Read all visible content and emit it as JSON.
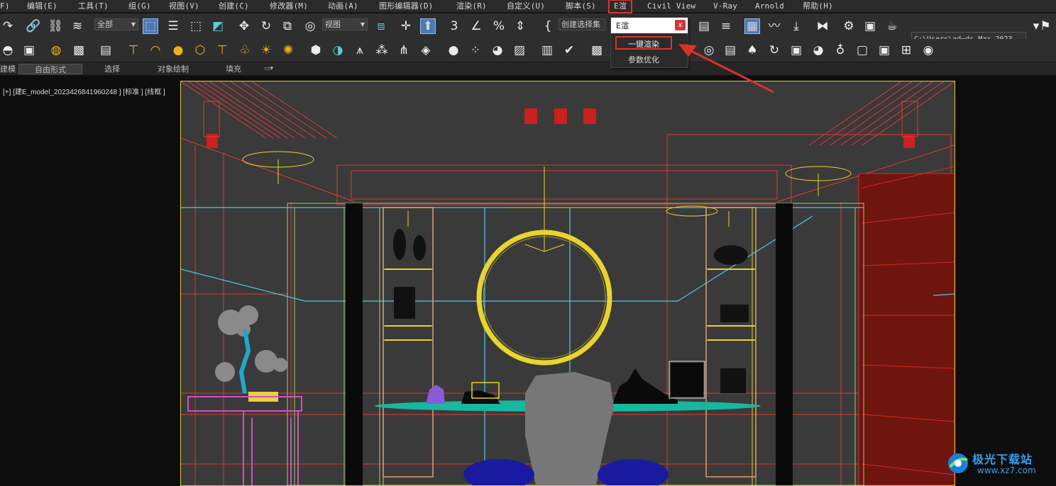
{
  "menubar": {
    "items": [
      "F)",
      "编辑(E)",
      "工具(T)",
      "组(G)",
      "视图(V)",
      "创建(C)",
      "修改器(M)",
      "动画(A)",
      "图形编辑器(D)",
      "渲染(R)",
      "自定义(U)",
      "脚本(S)",
      "E渲",
      "Civil View",
      "V-Ray",
      "Arnold",
      "帮助(H)"
    ],
    "highlighted_item": "E渲"
  },
  "toolbar1": {
    "selection_filter": "全部",
    "ref_coord": "视图",
    "named_selection": "创建选择集",
    "path_value": "C:\\Users\\ad⋯ds Max 2023",
    "icons": [
      "redo-icon",
      "link-icon",
      "unlink-icon",
      "bind-space-warp-icon",
      "select-object-icon",
      "select-by-name-icon",
      "rect-region-icon",
      "window-crossing-icon",
      "move-icon",
      "rotate-icon",
      "scale-icon",
      "placement-icon",
      "mirror-icon",
      "align-icon",
      "pivot-center-icon",
      "use-pivot-icon",
      "snap-3-icon",
      "angle-snap-icon",
      "percent-snap-icon",
      "spinner-snap-icon",
      "edit-named-selection-icon",
      "layer-explorer-icon",
      "toggle-ribbon-icon",
      "curve-editor-icon",
      "schematic-view-icon",
      "material-editor-icon",
      "render-setup-icon",
      "rendered-frame-icon",
      "render-icon",
      "render-production-icon"
    ]
  },
  "toolbar2": {
    "icons": [
      "vray-light-icon",
      "box-icon",
      "teapot-icon",
      "camera-icon",
      "film-icon",
      "spot-light-icon",
      "dome-light-icon",
      "sphere-light-icon",
      "mesh-light-icon",
      "ies-light-icon",
      "sun-icon",
      "sky-icon",
      "proxy-icon",
      "fur-icon",
      "plane-icon",
      "sphere-icon",
      "balls-icon",
      "palette-icon",
      "frame-buffer-icon",
      "stats-icon",
      "vray-logo-icon"
    ]
  },
  "ribbon": {
    "tabs": [
      "建模",
      "自由形式",
      "选择",
      "对象绘制",
      "填充"
    ]
  },
  "viewport": {
    "label": "[+] [建E_model_2023426841960248 ] [标准 ] [线框 ]"
  },
  "popup": {
    "title": "E渲",
    "close": "x",
    "items": [
      "一键渲染",
      "参数优化"
    ]
  },
  "watermark": {
    "name": "极光下载站",
    "url": "www.xz7.com"
  },
  "colors": {
    "menu_bg": "#2a2a2a",
    "toolbar_bg": "#2e2e2e",
    "viewport_bg": "#3a3a3a",
    "highlight_red": "#e0302a",
    "selected_blue": "#4a79b8",
    "wire_red": "#e23b32",
    "wire_yellow": "#e8d42c",
    "wire_cyan": "#4ec6e8",
    "watermark_blue": "#3b9fe8"
  }
}
